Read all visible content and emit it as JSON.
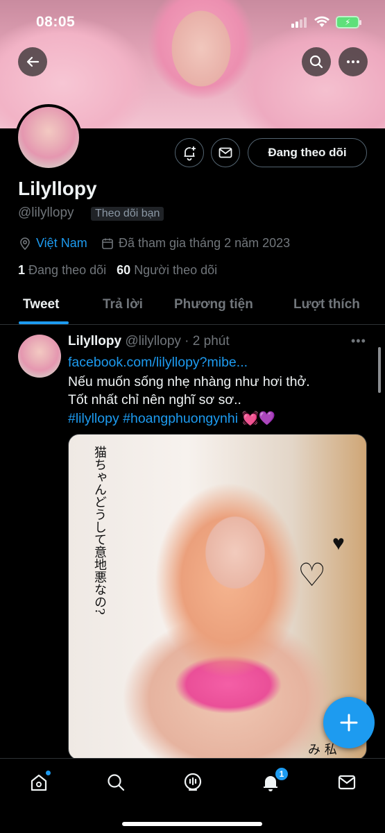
{
  "status_bar": {
    "time": "08:05"
  },
  "profile": {
    "display_name": "Lilyllopy",
    "handle": "@lilyllopy",
    "follows_you": "Theo dõi bạn",
    "location": "Việt Nam",
    "joined": "Đã tham gia tháng 2 năm 2023",
    "following_count": "1",
    "following_label": "Đang theo dõi",
    "followers_count": "60",
    "followers_label": "Người theo dõi",
    "follow_button": "Đang theo dõi"
  },
  "tabs": [
    {
      "label": "Tweet",
      "active": true
    },
    {
      "label": "Trả lời",
      "active": false
    },
    {
      "label": "Phương tiện",
      "active": false
    },
    {
      "label": "Lượt thích",
      "active": false
    }
  ],
  "tweet": {
    "name": "Lilyllopy",
    "handle": "@lilyllopy",
    "time": "· 2 phút",
    "link": "facebook.com/lilyllopy?mibe...",
    "line1": "Nếu muốn sống nhẹ nhàng như hơi thở.",
    "line2": "Tốt nhất chỉ nên nghĩ sơ sơ..",
    "hashtag1": "#lilyllopy",
    "hashtag2": "#hoangphuongynhi",
    "emojis": "💓💜",
    "media_text_top": "猫ちゃんどうして意地悪なの?",
    "media_text_bottom": "み 私"
  },
  "bottom_nav": {
    "notifications_badge": "1"
  },
  "colors": {
    "accent": "#1d9bf0",
    "background": "#000000",
    "secondary_text": "#71767b"
  }
}
